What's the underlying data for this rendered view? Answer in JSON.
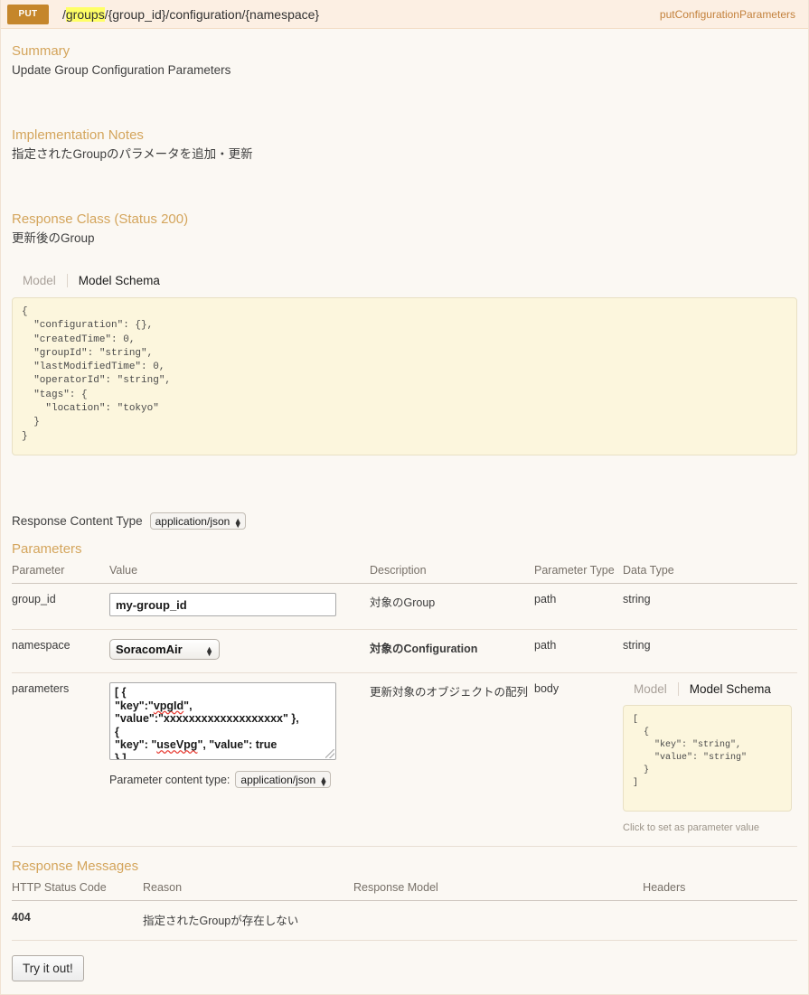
{
  "operation": {
    "method": "PUT",
    "path_prefix": "/",
    "path_highlight": "groups",
    "path_rest": "/{group_id}/configuration/{namespace}",
    "nickname": "putConfigurationParameters",
    "method_color": "#c5862b",
    "accent_color": "#d4a55c"
  },
  "summary": {
    "heading": "Summary",
    "text": "Update Group Configuration Parameters"
  },
  "implementation_notes": {
    "heading": "Implementation Notes",
    "text": "指定されたGroupのパラメータを追加・更新"
  },
  "response_class": {
    "heading": "Response Class (Status 200)",
    "text": "更新後のGroup",
    "tabs": {
      "model": "Model",
      "model_schema": "Model Schema"
    },
    "schema": "{\n  \"configuration\": {},\n  \"createdTime\": 0,\n  \"groupId\": \"string\",\n  \"lastModifiedTime\": 0,\n  \"operatorId\": \"string\",\n  \"tags\": {\n    \"location\": \"tokyo\"\n  }\n}"
  },
  "response_content_type": {
    "label": "Response Content Type",
    "selected": "application/json",
    "options": [
      "application/json"
    ]
  },
  "parameters_section": {
    "heading": "Parameters",
    "columns": [
      "Parameter",
      "Value",
      "Description",
      "Parameter Type",
      "Data Type"
    ],
    "rows": [
      {
        "name": "group_id",
        "value": "my-group_id",
        "control": "text",
        "description": "対象のGroup",
        "description_bold": false,
        "parameter_type": "path",
        "data_type": "string"
      },
      {
        "name": "namespace",
        "value": "SoracomAir",
        "control": "select",
        "options": [
          "SoracomAir"
        ],
        "description": "対象のConfiguration",
        "description_bold": true,
        "parameter_type": "path",
        "data_type": "string"
      },
      {
        "name": "parameters",
        "value": "[ {\n\"key\":\"vpgId\",\n\"value\":\"xxxxxxxxxxxxxxxxxxx\" },\n{\n\"key\": \"useVpg\", \"value\": true\n} ]",
        "control": "textarea",
        "description": "更新対象のオブジェクトの配列",
        "description_bold": false,
        "parameter_type": "body",
        "data_type": "",
        "content_type_label": "Parameter content type:",
        "content_type_selected": "application/json",
        "content_type_options": [
          "application/json"
        ],
        "model_tabs": {
          "model": "Model",
          "model_schema": "Model Schema"
        },
        "model_schema": "[\n  {\n    \"key\": \"string\",\n    \"value\": \"string\"\n  }\n]",
        "model_hint": "Click to set as parameter value"
      }
    ]
  },
  "response_messages": {
    "heading": "Response Messages",
    "columns": [
      "HTTP Status Code",
      "Reason",
      "Response Model",
      "Headers"
    ],
    "rows": [
      {
        "code": "404",
        "reason": "指定されたGroupが存在しない",
        "response_model": "",
        "headers": ""
      }
    ]
  },
  "submit": {
    "label": "Try it out!"
  }
}
